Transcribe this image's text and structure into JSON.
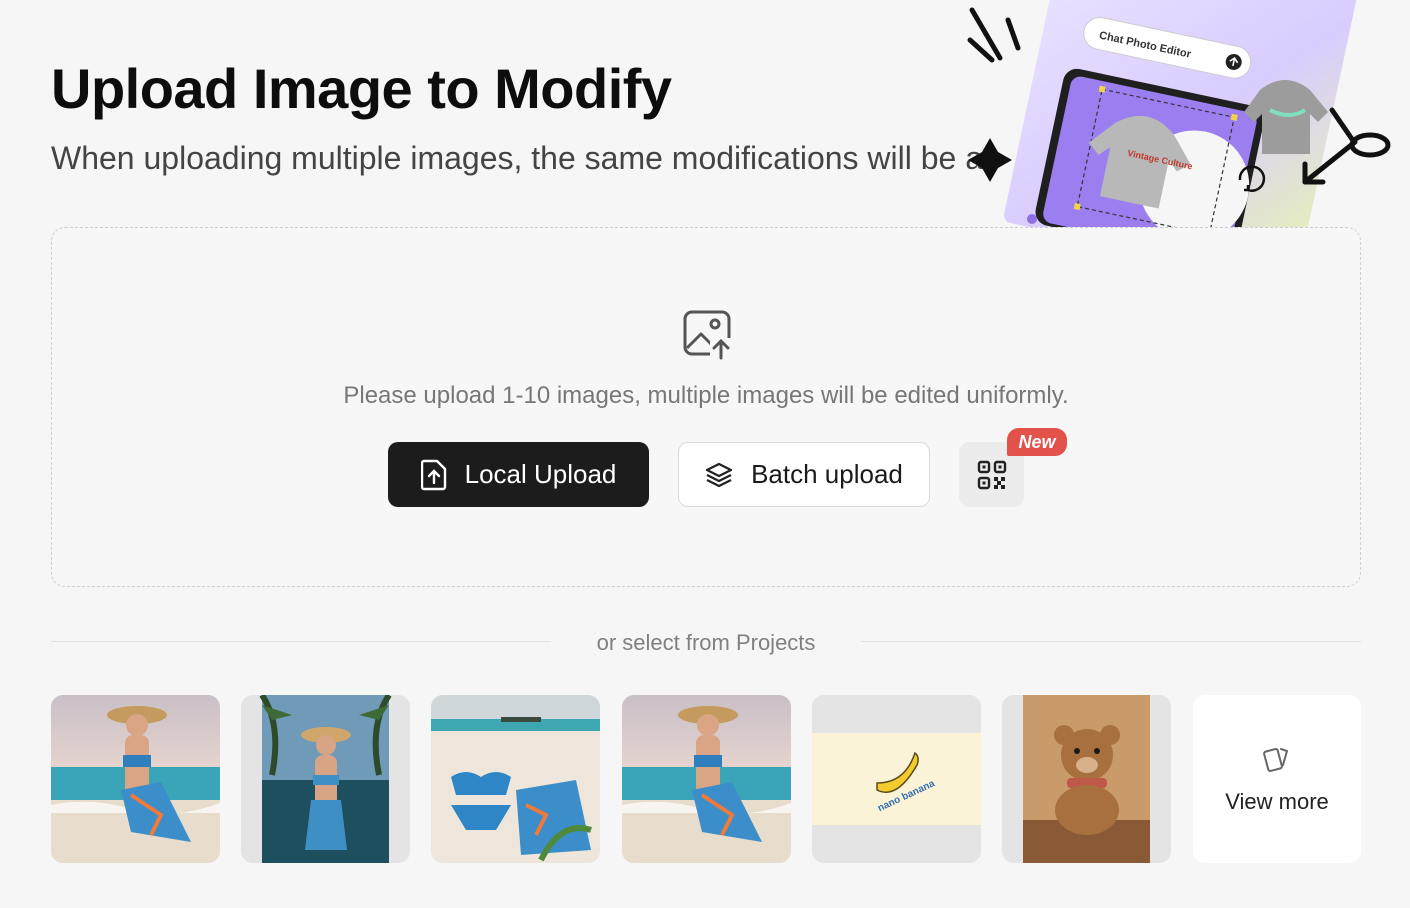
{
  "header": {
    "title": "Upload Image to Modify",
    "subtitle": "When uploading multiple images, the same modifications will be a"
  },
  "hero": {
    "card_title": "Chat Photo Editor",
    "card_heading_fragment": "tor",
    "hoodie_text": "Vintage Culture"
  },
  "upload": {
    "hint": "Please upload 1-10 images, multiple images will be edited uniformly.",
    "local_upload_label": "Local Upload",
    "batch_upload_label": "Batch upload",
    "qr_badge": "New"
  },
  "projects": {
    "divider_label": "or select from Projects",
    "items": [
      {
        "subject": "woman in sun hat and floral bikini on beach"
      },
      {
        "subject": "woman in sun hat by infinity pool with palm trees"
      },
      {
        "subject": "floral bikini and sarong laid on sand"
      },
      {
        "subject": "woman in sun hat and floral bikini on beach"
      },
      {
        "subject": "banana logo sticker",
        "sticker_text": "nano banana"
      },
      {
        "subject": "teddy bear on wooden table"
      }
    ],
    "view_more_label": "View more"
  },
  "colors": {
    "primary_button": "#1c1c1c",
    "badge": "#e2514a",
    "accent_purple": "#9b7ff0"
  }
}
